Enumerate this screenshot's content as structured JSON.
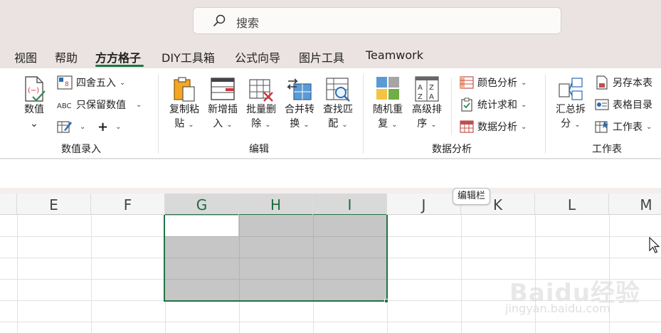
{
  "search": {
    "label": "搜索"
  },
  "tabs": [
    {
      "label": "视图",
      "active": false
    },
    {
      "label": "帮助",
      "active": false
    },
    {
      "label": "方方格子",
      "active": true
    },
    {
      "label": "DIY工具箱",
      "active": false
    },
    {
      "label": "公式向导",
      "active": false
    },
    {
      "label": "图片工具",
      "active": false
    },
    {
      "label": "Teamwork",
      "active": false
    }
  ],
  "ribbon": {
    "numeric_entry": {
      "group_label": "数值录入",
      "value_button": {
        "line1": "数值",
        "chevron": "⌄"
      },
      "round_button": "四舍五入",
      "keep_values_button": "只保留数值",
      "plus_symbol": "+"
    },
    "edit": {
      "group_label": "编辑",
      "copy_paste": {
        "line1": "复制粘",
        "line2": "贴"
      },
      "add_insert": {
        "line1": "新增插",
        "line2": "入"
      },
      "batch_delete": {
        "line1": "批量删",
        "line2": "除"
      },
      "merge_convert": {
        "line1": "合并转",
        "line2": "换"
      },
      "find_match": {
        "line1": "查找匹",
        "line2": "配"
      }
    },
    "data_analysis": {
      "group_label": "数据分析",
      "random_repeat": {
        "line1": "随机重",
        "line2": "复"
      },
      "advanced_sort": {
        "line1": "高级排",
        "line2": "序"
      },
      "color_analysis": "颜色分析",
      "count_sum": "统计求和",
      "data_analysis_button": "数据分析"
    },
    "worksheet": {
      "group_label": "工作表",
      "summary_split": {
        "line1": "汇总拆",
        "line2": "分"
      },
      "save_as_sheet": "另存本表",
      "sheet_index": "表格目录",
      "worksheet_button": "工作表"
    }
  },
  "tooltip": "编辑栏",
  "columns": [
    "E",
    "F",
    "G",
    "H",
    "I",
    "J",
    "K",
    "L",
    "M"
  ],
  "selected_columns": [
    "G",
    "H",
    "I"
  ],
  "watermark": {
    "brand": "Baidu经验",
    "url": "jingyan.baidu.com"
  },
  "colors": {
    "accent": "#217346",
    "selection": "#c6c6c6",
    "title_bar": "#ebe3e1"
  }
}
